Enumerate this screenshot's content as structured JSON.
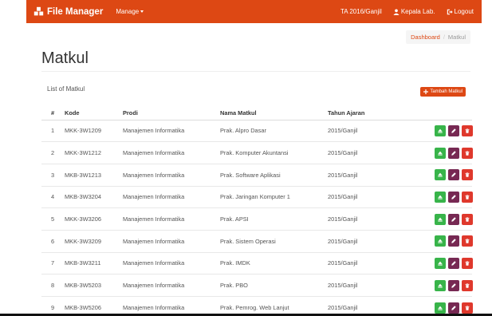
{
  "navbar": {
    "brand": "File Manager",
    "manage_label": "Manage",
    "period": "TA 2016/Ganjil",
    "user": "Kepala Lab.",
    "logout": "Logout"
  },
  "breadcrumb": {
    "home": "Dashboard",
    "separator": "/",
    "current": "Matkul"
  },
  "page": {
    "title": "Matkul",
    "list_label": "List of Matkul",
    "add_button": "Tambah Matkul"
  },
  "table": {
    "headers": [
      "#",
      "Kode",
      "Prodi",
      "Nama Matkul",
      "Tahun Ajaran"
    ],
    "rows": [
      [
        "1",
        "MKK-3W1209",
        "Manajemen Informatika",
        "Prak. Alpro Dasar",
        "2015/Ganjil"
      ],
      [
        "2",
        "MKK-3W1212",
        "Manajemen Informatika",
        "Prak. Komputer Akuntansi",
        "2015/Ganjil"
      ],
      [
        "3",
        "MKB-3W1213",
        "Manajemen Informatika",
        "Prak. Software Aplikasi",
        "2015/Ganjil"
      ],
      [
        "4",
        "MKB-3W3204",
        "Manajemen Informatika",
        "Prak. Jaringan Komputer 1",
        "2015/Ganjil"
      ],
      [
        "5",
        "MKK-3W3206",
        "Manajemen Informatika",
        "Prak. APSI",
        "2015/Ganjil"
      ],
      [
        "6",
        "MKK-3W3209",
        "Manajemen Informatika",
        "Prak. Sistem Operasi",
        "2015/Ganjil"
      ],
      [
        "7",
        "MKB-3W3211",
        "Manajemen Informatika",
        "Prak. IMDK",
        "2015/Ganjil"
      ],
      [
        "8",
        "MKB-3W5203",
        "Manajemen Informatika",
        "Prak. PBO",
        "2015/Ganjil"
      ],
      [
        "9",
        "MKB-3W5206",
        "Manajemen Informatika",
        "Prak. Pemrog. Web Lanjut",
        "2015/Ganjil"
      ]
    ]
  },
  "icons": {
    "brand": "stacked-boxes-icon",
    "user": "user-icon",
    "logout": "logout-icon",
    "add": "plus-icon",
    "view": "eject-icon",
    "edit": "pencil-icon",
    "delete": "trash-icon"
  },
  "colors": {
    "primary": "#dd4814",
    "success": "#38b44a",
    "edit": "#772953",
    "danger": "#df382c"
  }
}
